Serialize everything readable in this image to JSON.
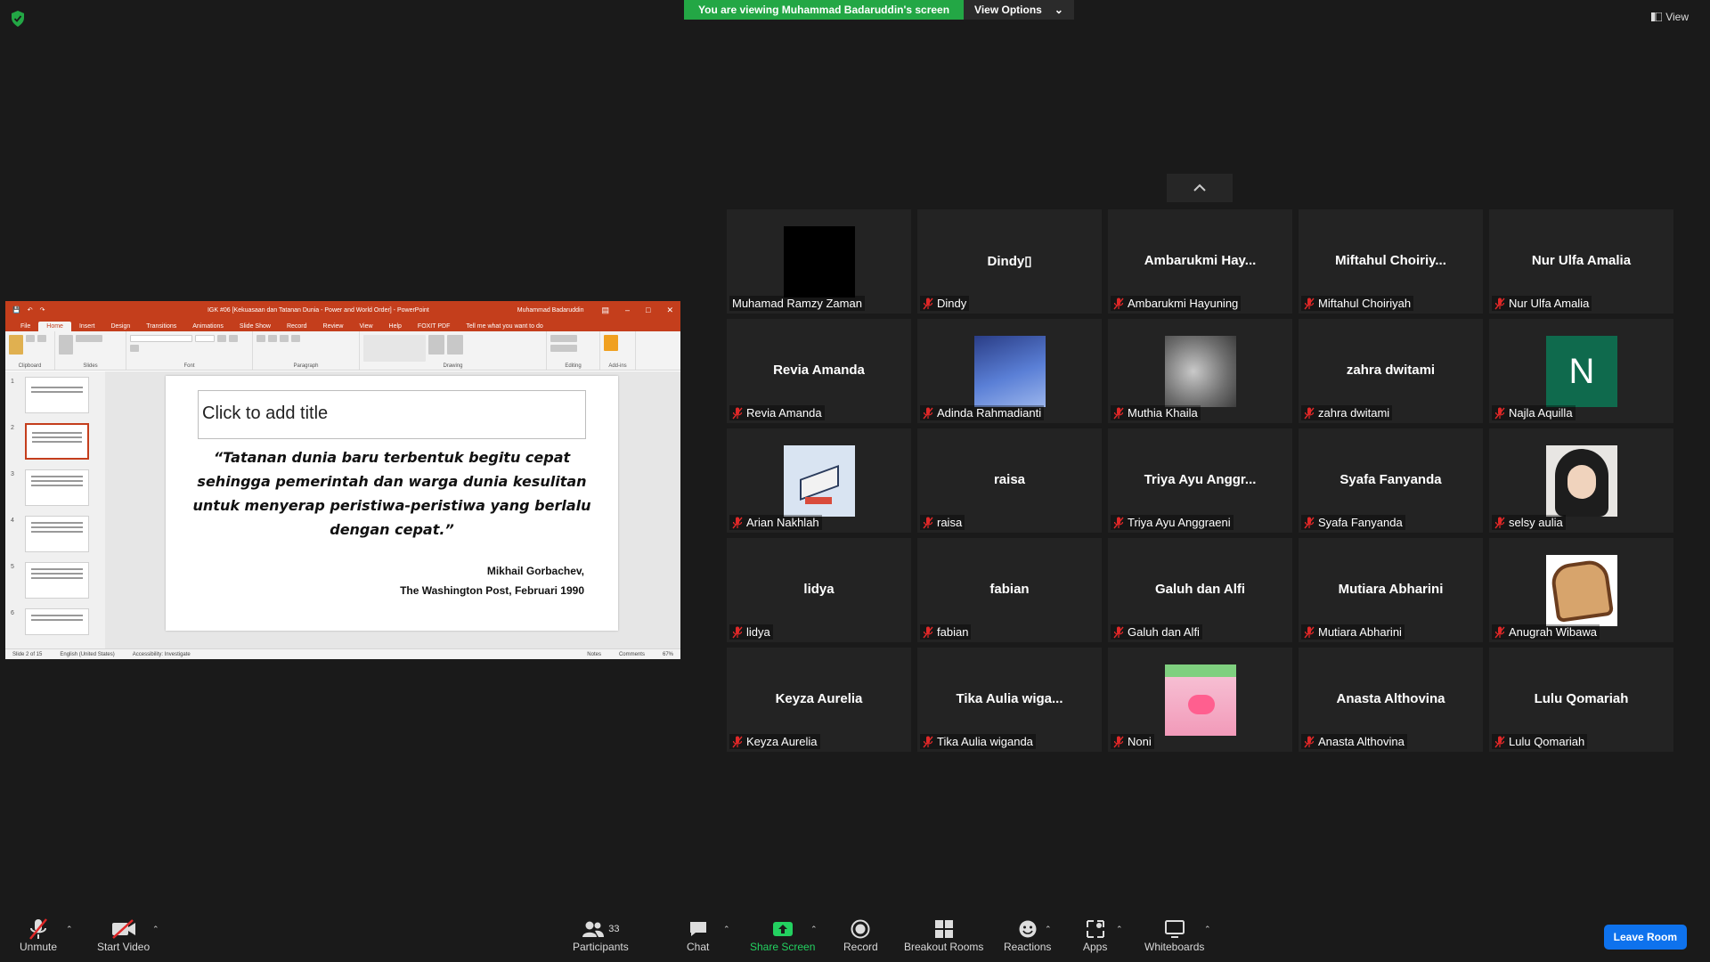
{
  "top": {
    "viewing": "You are viewing Muhammad Badaruddin's screen",
    "view_options": "View Options",
    "view": "View"
  },
  "ppt": {
    "doc_title": "IGK #06 [Kekuasaan dan Tatanan Dunia - Power and World Order] - PowerPoint",
    "user": "Muhammad Badaruddin",
    "tabs": [
      "File",
      "Home",
      "Insert",
      "Design",
      "Transitions",
      "Animations",
      "Slide Show",
      "Record",
      "Review",
      "View",
      "Help",
      "FOXIT PDF",
      "Tell me what you want to do"
    ],
    "groups": [
      "Clipboard",
      "Slides",
      "Font",
      "Paragraph",
      "Drawing",
      "Editing",
      "Add-ins"
    ],
    "title_placeholder": "Click to add title",
    "quote": "“Tatanan dunia baru terbentuk begitu cepat sehingga pemerintah dan warga dunia kesulitan untuk menyerap peristiwa-peristiwa yang berlalu dengan cepat.”",
    "author": "Mikhail Gorbachev,",
    "source": "The Washington Post, Februari 1990",
    "status": {
      "slide": "Slide 2 of 15",
      "lang": "English (United States)",
      "access": "Accessibility: Investigate",
      "notes": "Notes",
      "comments": "Comments",
      "zoom": "67%"
    }
  },
  "participants": [
    {
      "big": "",
      "name": "Muhamad Ramzy Zaman",
      "muted": false,
      "img": "black"
    },
    {
      "big": "Dindy▯",
      "name": "Dindy",
      "muted": true,
      "img": ""
    },
    {
      "big": "Ambarukmi  Hay...",
      "name": "Ambarukmi Hayuning",
      "muted": true,
      "img": ""
    },
    {
      "big": "Miftahul  Choiriy...",
      "name": "Miftahul Choiriyah",
      "muted": true,
      "img": ""
    },
    {
      "big": "Nur Ulfa Amalia",
      "name": "Nur Ulfa Amalia",
      "muted": true,
      "img": ""
    },
    {
      "big": "Revia Amanda",
      "name": "Revia Amanda",
      "muted": true,
      "img": ""
    },
    {
      "big": "",
      "name": "Adinda Rahmadianti",
      "muted": true,
      "img": "sky"
    },
    {
      "big": "",
      "name": "Muthia Khaila",
      "muted": true,
      "img": "gray"
    },
    {
      "big": "zahra dwitami",
      "name": "zahra dwitami",
      "muted": true,
      "img": ""
    },
    {
      "big": "",
      "name": "Najla Aquilla",
      "muted": true,
      "img": "letter",
      "letter": "N"
    },
    {
      "big": "",
      "name": "Arian Nakhlah",
      "muted": true,
      "img": "iso"
    },
    {
      "big": "raisa",
      "name": "raisa",
      "muted": true,
      "img": ""
    },
    {
      "big": "Triya Ayu Anggr...",
      "name": "Triya Ayu Anggraeni",
      "muted": true,
      "img": ""
    },
    {
      "big": "Syafa Fanyanda",
      "name": "Syafa Fanyanda",
      "muted": true,
      "img": ""
    },
    {
      "big": "",
      "name": "selsy aulia",
      "muted": true,
      "img": "person"
    },
    {
      "big": "lidya",
      "name": "lidya",
      "muted": true,
      "img": ""
    },
    {
      "big": "fabian",
      "name": "fabian",
      "muted": true,
      "img": ""
    },
    {
      "big": "Galuh dan Alfi",
      "name": "Galuh dan Alfi",
      "muted": true,
      "img": ""
    },
    {
      "big": "Mutiara Abharini",
      "name": "Mutiara Abharini",
      "muted": true,
      "img": ""
    },
    {
      "big": "",
      "name": "Anugrah Wibawa",
      "muted": true,
      "img": "toast"
    },
    {
      "big": "Keyza Aurelia",
      "name": "Keyza Aurelia",
      "muted": true,
      "img": ""
    },
    {
      "big": "Tika  Aulia  wiga...",
      "name": "Tika Aulia wiganda",
      "muted": true,
      "img": ""
    },
    {
      "big": "",
      "name": "Noni",
      "muted": true,
      "img": "pink"
    },
    {
      "big": "Anasta Althovina",
      "name": "Anasta Althovina",
      "muted": true,
      "img": ""
    },
    {
      "big": "Lulu  Qomariah",
      "name": "Lulu  Qomariah",
      "muted": true,
      "img": ""
    }
  ],
  "toolbar": {
    "unmute": "Unmute",
    "start_video": "Start Video",
    "participants": "Participants",
    "participants_count": "33",
    "chat": "Chat",
    "share": "Share Screen",
    "record": "Record",
    "breakout": "Breakout Rooms",
    "reactions": "Reactions",
    "apps": "Apps",
    "whiteboards": "Whiteboards",
    "leave": "Leave Room"
  },
  "colors": {
    "green": "#23a745",
    "ppt_red": "#c43e1c",
    "leave_blue": "#0e72ed",
    "mute_red": "#e02828"
  }
}
